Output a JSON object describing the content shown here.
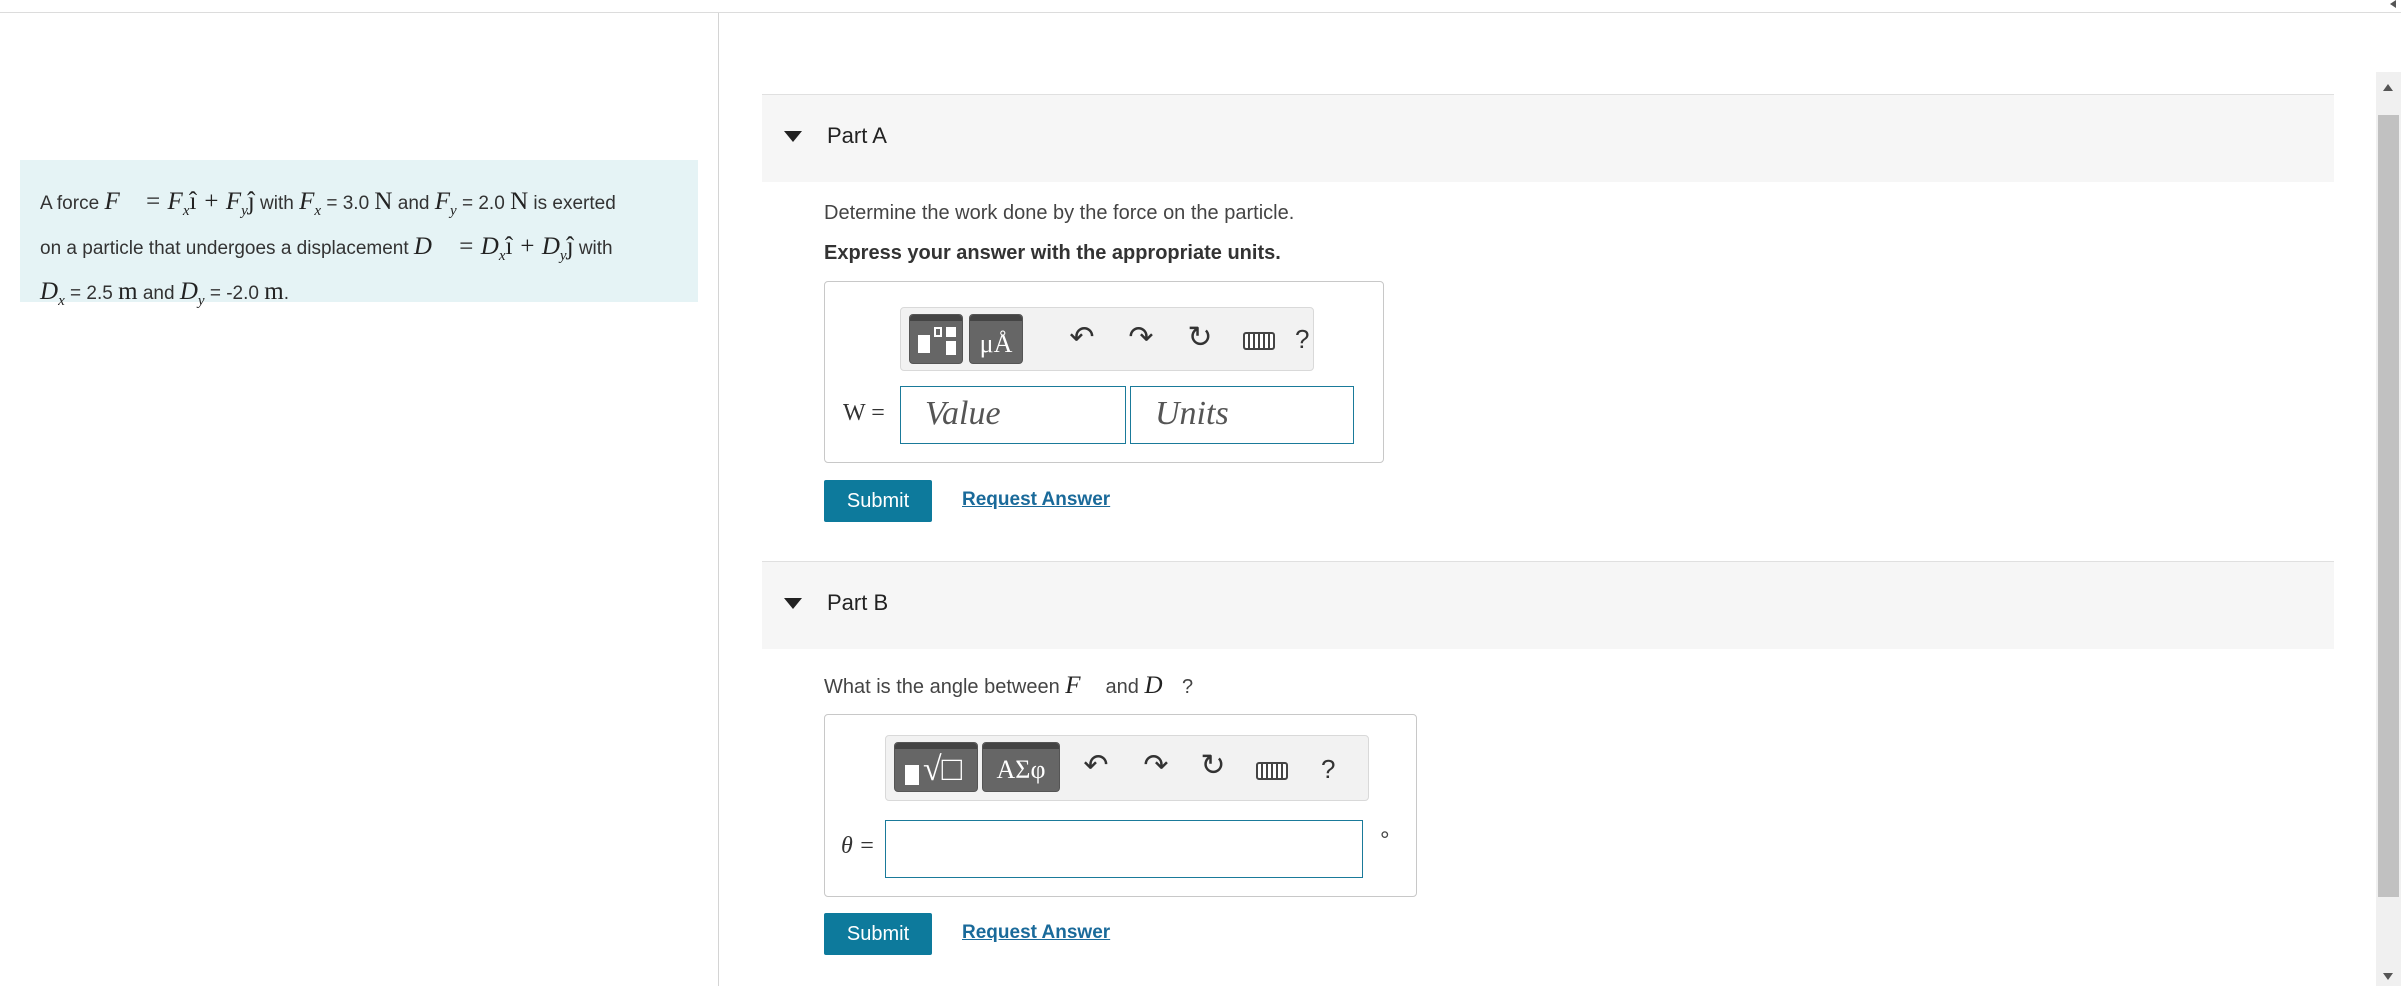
{
  "problem": {
    "t1": "A force",
    "F_def": "F⃗ = F",
    "t2": "with",
    "t3": "= 3.0",
    "t4": "and",
    "t5": "= 2.0",
    "t6": "is exerted",
    "t7": "on a particle that undergoes a displacement",
    "t8": "with",
    "t9": "= 2.5",
    "t10": "and",
    "t11": "= -2.0",
    "unit_N": "N",
    "unit_m": "m"
  },
  "partA": {
    "title": "Part A",
    "question": "Determine the work done by the force on the particle.",
    "instruction": "Express your answer with the appropriate units.",
    "toolbar": {
      "btn2_label": "μÅ",
      "help": "?"
    },
    "var_label": "W =",
    "value_placeholder": "Value",
    "units_placeholder": "Units",
    "submit": "Submit",
    "request": "Request Answer"
  },
  "partB": {
    "title": "Part B",
    "question_pre": "What is the angle between",
    "question_mid": "and",
    "question_post": "?",
    "toolbar": {
      "btn1_label": "√□",
      "btn2_label": "ΑΣφ",
      "help": "?"
    },
    "var_label": "θ =",
    "degree": "°",
    "submit": "Submit",
    "request": "Request Answer"
  },
  "icons": [
    "template-icon",
    "units-symbol-icon",
    "undo-icon",
    "redo-icon",
    "reset-icon",
    "keyboard-icon",
    "help-icon"
  ]
}
